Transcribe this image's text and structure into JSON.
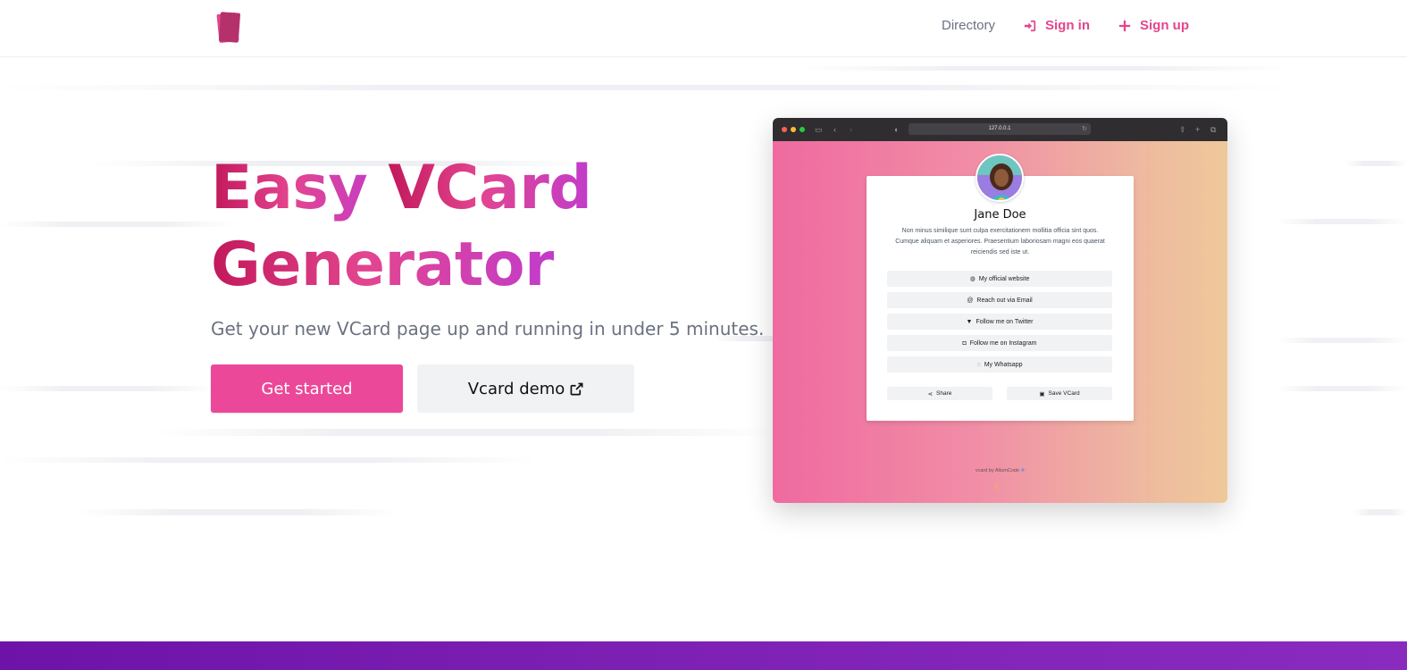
{
  "nav": {
    "directory": "Directory",
    "sign_in": "Sign in",
    "sign_up": "Sign up"
  },
  "hero": {
    "title_part1": "Easy ",
    "title_part2": "VCard",
    "title_line2": "Generator",
    "subtitle": "Get your new VCard page up and running in under 5 minutes.",
    "primary_button": "Get started",
    "secondary_button": "Vcard demo"
  },
  "mockup": {
    "url": "127.0.0.1",
    "card": {
      "name": "Jane Doe",
      "bio": "Non minus similique sunt culpa exercitationem mollitia officia sint quos. Cumque aliquam et asperiores. Praesentium laboriosam magni eos quaerat reiciendis sed iste ut.",
      "links": [
        {
          "icon": "globe-icon",
          "label": "My official website"
        },
        {
          "icon": "at-icon",
          "label": "Reach out via Email"
        },
        {
          "icon": "twitter-icon",
          "label": "Follow me on Twitter"
        },
        {
          "icon": "instagram-icon",
          "label": "Follow me on Instagram"
        },
        {
          "icon": "whatsapp-icon",
          "label": "My Whatsapp"
        }
      ],
      "share": "Share",
      "save": "Save VCard"
    },
    "footer": "vcard by AltumCode"
  },
  "colors": {
    "accent": "#ec4899",
    "title_gradient_start": "#c2185b",
    "title_gradient_end": "#c13ccb",
    "bottom_band": "#6d13a8"
  }
}
